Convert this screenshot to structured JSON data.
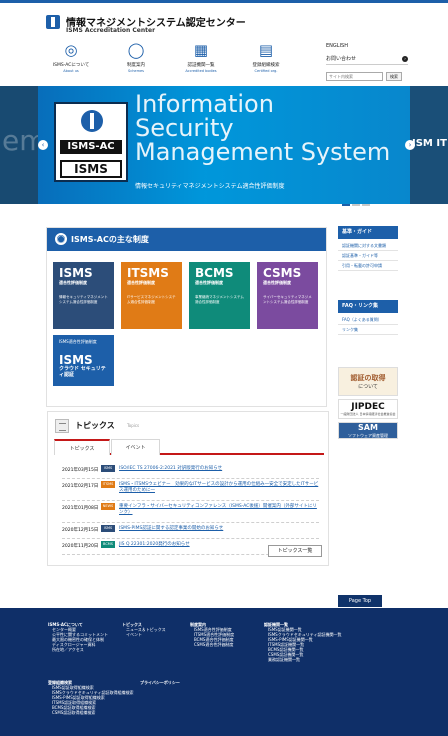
{
  "header": {
    "title": "情報マネジメントシステム認定センター",
    "subtitle": "ISMS Accreditation Center"
  },
  "nav": [
    {
      "label": "ISMS-ACについて",
      "en": "About us",
      "icon": "logo-icon"
    },
    {
      "label": "制度案内",
      "en": "Schemes",
      "icon": "globe-icon"
    },
    {
      "label": "認証機関一覧",
      "en": "Accredited bodies",
      "icon": "building-icon"
    },
    {
      "label": "登録組織検索",
      "en": "Certified org.",
      "icon": "document-icon"
    }
  ],
  "util": {
    "english": "ENGLISH",
    "contact": "お問い合わせ",
    "search_placeholder": "サイト内検索",
    "search_button": "検索"
  },
  "hero": {
    "left_text": "em",
    "right_text": "ISM\nIT",
    "badge_top": "ISMS-AC",
    "badge_bottom": "ISMS",
    "line1": "Information",
    "line2": "Security",
    "line3": "Management System",
    "sub": "情報セキュリティマネジメントシステム適合性評価制度"
  },
  "main": {
    "section_title": "ISMS-ACの主な制度",
    "cards": [
      {
        "title": "ISMS",
        "sub": "適合性評価制度",
        "desc": "情報セキュリティマネジメントシステム適合性評価制度"
      },
      {
        "title": "ITSMS",
        "sub": "適合性評価制度",
        "desc": "ITサービスマネジメントシステム適合性評価制度"
      },
      {
        "title": "BCMS",
        "sub": "適合性評価制度",
        "desc": "事業継続マネジメントシステム適合性評価制度"
      },
      {
        "title": "CSMS",
        "sub": "適合性評価制度",
        "desc": "サイバーセキュリティマネジメントシステム適合性評価制度"
      }
    ],
    "cloud": {
      "head": "ISMS適合性評価制度",
      "title": "ISMS",
      "sub": "クラウド セキュリティ認証"
    }
  },
  "rail": {
    "guide_title": "基準・ガイド",
    "guide_links": [
      "認証機関に対する文書類",
      "認証基準・ガイド等",
      "引用・転載の許可申請"
    ],
    "faq_title": "FAQ・リンク集",
    "faq_links": [
      "FAQ（よくある質問）",
      "リンク集"
    ],
    "banner_cert_1": "認証の取得",
    "banner_cert_2": "について",
    "banner_jipdec": "JIPDEC",
    "banner_jipdec_sub": "一般財団法人 日本情報経済社会推進協会",
    "banner_sam": "SAM",
    "banner_sam_sub": "ソフトウェア資産管理"
  },
  "topics": {
    "title": "トピックス",
    "sub": "Topics",
    "tab_topics": "トピックス",
    "tab_events": "イベント",
    "items": [
      {
        "date": "2021年03月15日",
        "tag": "ISMS",
        "tag_color": "#2c4d79",
        "text": "ISO/IEC TS 27006-2:2021 対訳版発行のお知らせ"
      },
      {
        "date": "2021年02月17日",
        "tag": "ITSMS",
        "tag_color": "#e07b16",
        "text": "ISMS・ITSMSウェビナー　効果的なITサービスの設計から運用の仕組み一安全で安定したITサービス運用のために一"
      },
      {
        "date": "2021年01月08日",
        "tag": "NEWS",
        "tag_color": "#e07b16",
        "text": "重要インフラ・サイバーセキュリティコンファレンス（ISMS-AC後援）開催案内（外部サイトにリンク）"
      },
      {
        "date": "2020年12月15日",
        "tag": "ISMS",
        "tag_color": "#2c4d79",
        "text": "ISMS-PIMS認証に関する認定事業の開始のお知らせ"
      },
      {
        "date": "2020年11月20日",
        "tag": "BCMS",
        "tag_color": "#0f8b7a",
        "text": "JIS Q 22301:2020発行のお知らせ"
      }
    ],
    "more": "トピックス一覧"
  },
  "pagetop": "Page Top",
  "footer": {
    "col1_head": "ISMS-ACについて",
    "col1_items": [
      "センター概要",
      "公平性に関するコミットメント",
      "最大限の機密性の確保と体制",
      "ディスクロージャー資料",
      "所在地／アクセス"
    ],
    "col2_head": "トピックス",
    "col2_items": [
      "ニュース＆トピックス",
      "イベント"
    ],
    "col3_head": "制度案内",
    "col3_items": [
      "ISMS適合性評価制度",
      "ITSMS適合性評価制度",
      "BCMS適合性評価制度",
      "CSMS適合性評価制度"
    ],
    "col4_head": "認証機関一覧",
    "col4_items": [
      "ISMS認証機関一覧",
      "ISMSクラウドセキュリティ認証機関一覧",
      "ISMS-PIMS認証機関一覧",
      "ITSMS認証機関一覧",
      "BCMS認証機関一覧",
      "CSMS認証機関一覧",
      "業務認証機関一覧"
    ],
    "col5_head": "登録組織検索",
    "col5_items": [
      "ISMS認証取得組織検索",
      "ISMSクラウドセキュリティ認証取得組織検索",
      "ISMS-PIMS認証取得組織検索",
      "ITSMS認証取得組織検索",
      "BCMS認証取得組織検索",
      "CSMS認証取得組織検索"
    ],
    "col6_head": "プライバシーポリシー"
  }
}
